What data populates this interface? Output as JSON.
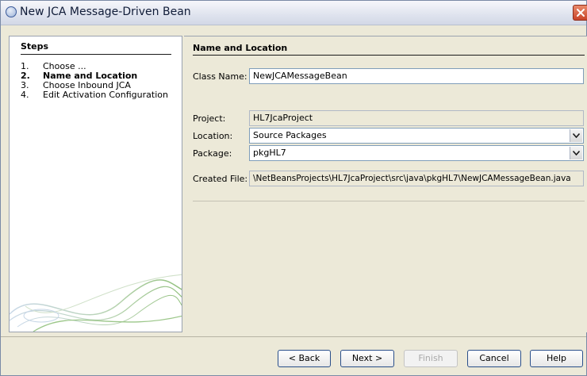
{
  "window": {
    "title": "New JCA Message-Driven Bean"
  },
  "steps": {
    "header": "Steps",
    "items": [
      {
        "num": "1.",
        "label": "Choose ...",
        "current": false
      },
      {
        "num": "2.",
        "label": "Name and Location",
        "current": true
      },
      {
        "num": "3.",
        "label": "Choose Inbound JCA",
        "current": false
      },
      {
        "num": "4.",
        "label": "Edit Activation Configuration",
        "current": false
      }
    ]
  },
  "form": {
    "section_title": "Name and Location",
    "class_name": {
      "label": "Class Name:",
      "value": "NewJCAMessageBean"
    },
    "project": {
      "label": "Project:",
      "value": "HL7JcaProject"
    },
    "location": {
      "label": "Location:",
      "value": "Source Packages"
    },
    "package": {
      "label": "Package:",
      "value": "pkgHL7"
    },
    "created_file": {
      "label": "Created File:",
      "value": "\\NetBeansProjects\\HL7JcaProject\\src\\java\\pkgHL7\\NewJCAMessageBean.java"
    }
  },
  "buttons": {
    "back": "< Back",
    "next": "Next >",
    "finish": "Finish",
    "cancel": "Cancel",
    "help": "Help"
  }
}
